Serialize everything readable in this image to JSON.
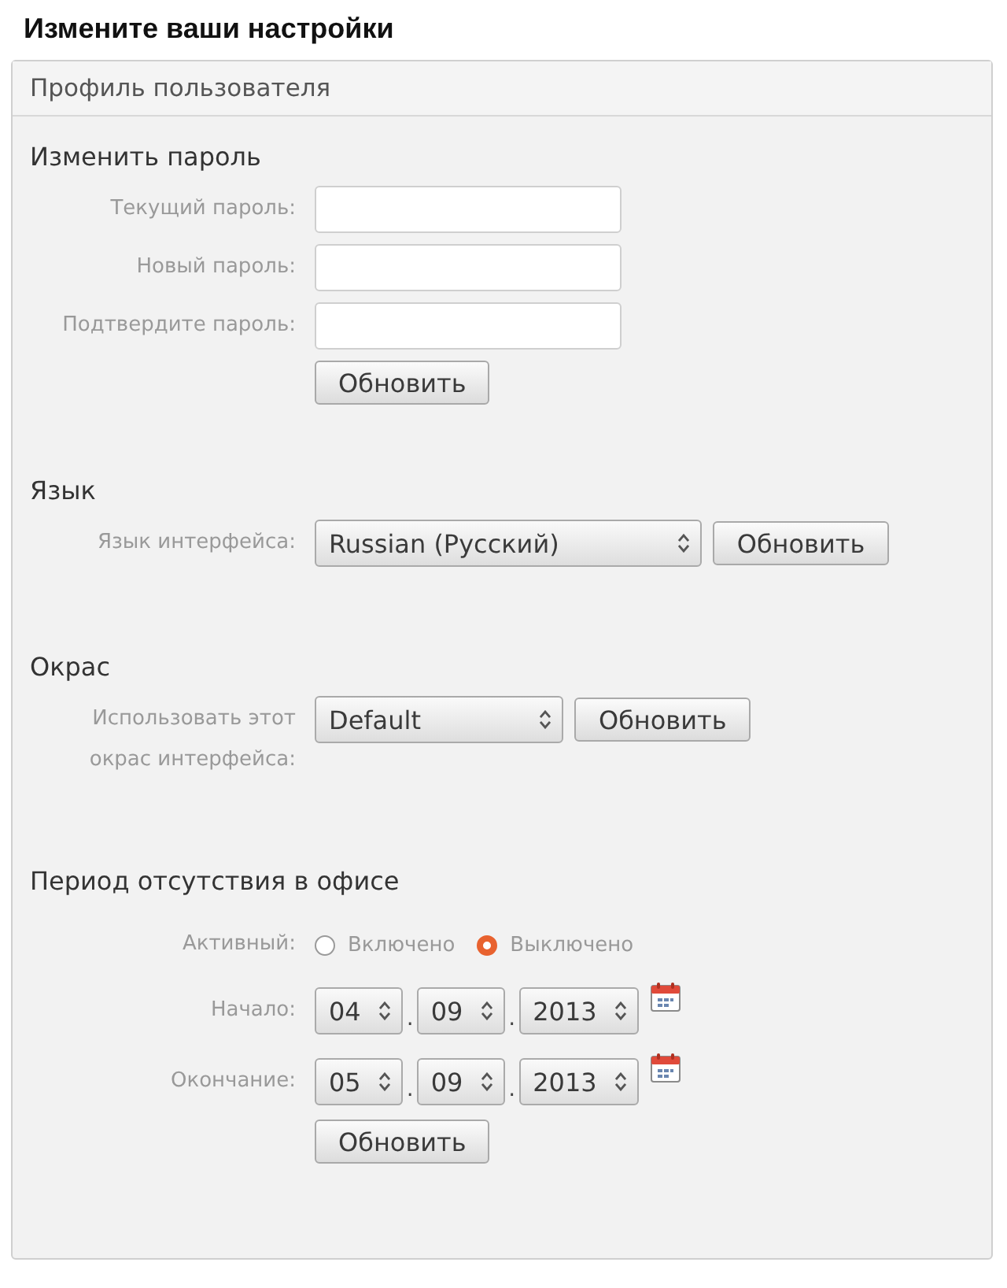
{
  "page_title": "Измените ваши настройки",
  "panel": {
    "title": "Профиль пользователя"
  },
  "sections": [
    {
      "kind": "password",
      "heading": "Изменить пароль",
      "fields": [
        {
          "label": "Текущий пароль:"
        },
        {
          "label": "Новый пароль:"
        },
        {
          "label": "Подтвердите пароль:"
        }
      ],
      "button": "Обновить"
    },
    {
      "kind": "select",
      "heading": "Язык",
      "label": "Язык интерфейса:",
      "value": "Russian (Русский)",
      "button": "Обновить"
    },
    {
      "kind": "select",
      "heading": "Окрас",
      "label": "Использовать этот окрас интерфейса:",
      "value": "Default",
      "button": "Обновить"
    },
    {
      "kind": "absence",
      "heading": "Период отсутствия в офисе",
      "active": {
        "label": "Активный:",
        "options": [
          {
            "label": "Включено",
            "selected": false
          },
          {
            "label": "Выключено",
            "selected": true
          }
        ]
      },
      "dates": [
        {
          "label": "Начало:",
          "segments": [
            {
              "kind": "spin",
              "text": "04"
            },
            {
              "kind": "sep",
              "text": "."
            },
            {
              "kind": "spin",
              "text": "09"
            },
            {
              "kind": "sep",
              "text": "."
            },
            {
              "kind": "spin",
              "text": "2013"
            }
          ]
        },
        {
          "label": "Окончание:",
          "segments": [
            {
              "kind": "spin",
              "text": "05"
            },
            {
              "kind": "sep",
              "text": "."
            },
            {
              "kind": "spin",
              "text": "09"
            },
            {
              "kind": "sep",
              "text": "."
            },
            {
              "kind": "spin",
              "text": "2013"
            }
          ]
        }
      ],
      "button": "Обновить"
    }
  ]
}
